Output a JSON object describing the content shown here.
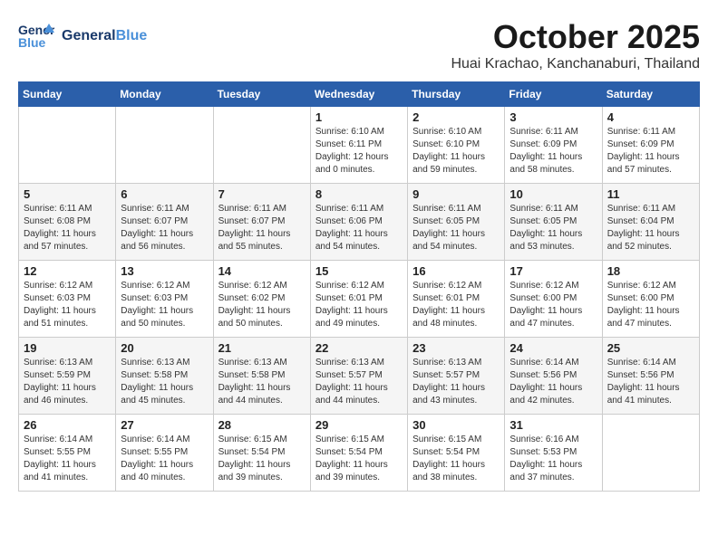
{
  "header": {
    "logo": {
      "line1": "General",
      "line2": "Blue",
      "tagline": ""
    },
    "month": "October 2025",
    "location": "Huai Krachao, Kanchanaburi, Thailand"
  },
  "weekdays": [
    "Sunday",
    "Monday",
    "Tuesday",
    "Wednesday",
    "Thursday",
    "Friday",
    "Saturday"
  ],
  "rows": [
    [
      {
        "day": "",
        "content": ""
      },
      {
        "day": "",
        "content": ""
      },
      {
        "day": "",
        "content": ""
      },
      {
        "day": "1",
        "content": "Sunrise: 6:10 AM\nSunset: 6:11 PM\nDaylight: 12 hours\nand 0 minutes."
      },
      {
        "day": "2",
        "content": "Sunrise: 6:10 AM\nSunset: 6:10 PM\nDaylight: 11 hours\nand 59 minutes."
      },
      {
        "day": "3",
        "content": "Sunrise: 6:11 AM\nSunset: 6:09 PM\nDaylight: 11 hours\nand 58 minutes."
      },
      {
        "day": "4",
        "content": "Sunrise: 6:11 AM\nSunset: 6:09 PM\nDaylight: 11 hours\nand 57 minutes."
      }
    ],
    [
      {
        "day": "5",
        "content": "Sunrise: 6:11 AM\nSunset: 6:08 PM\nDaylight: 11 hours\nand 57 minutes."
      },
      {
        "day": "6",
        "content": "Sunrise: 6:11 AM\nSunset: 6:07 PM\nDaylight: 11 hours\nand 56 minutes."
      },
      {
        "day": "7",
        "content": "Sunrise: 6:11 AM\nSunset: 6:07 PM\nDaylight: 11 hours\nand 55 minutes."
      },
      {
        "day": "8",
        "content": "Sunrise: 6:11 AM\nSunset: 6:06 PM\nDaylight: 11 hours\nand 54 minutes."
      },
      {
        "day": "9",
        "content": "Sunrise: 6:11 AM\nSunset: 6:05 PM\nDaylight: 11 hours\nand 54 minutes."
      },
      {
        "day": "10",
        "content": "Sunrise: 6:11 AM\nSunset: 6:05 PM\nDaylight: 11 hours\nand 53 minutes."
      },
      {
        "day": "11",
        "content": "Sunrise: 6:11 AM\nSunset: 6:04 PM\nDaylight: 11 hours\nand 52 minutes."
      }
    ],
    [
      {
        "day": "12",
        "content": "Sunrise: 6:12 AM\nSunset: 6:03 PM\nDaylight: 11 hours\nand 51 minutes."
      },
      {
        "day": "13",
        "content": "Sunrise: 6:12 AM\nSunset: 6:03 PM\nDaylight: 11 hours\nand 50 minutes."
      },
      {
        "day": "14",
        "content": "Sunrise: 6:12 AM\nSunset: 6:02 PM\nDaylight: 11 hours\nand 50 minutes."
      },
      {
        "day": "15",
        "content": "Sunrise: 6:12 AM\nSunset: 6:01 PM\nDaylight: 11 hours\nand 49 minutes."
      },
      {
        "day": "16",
        "content": "Sunrise: 6:12 AM\nSunset: 6:01 PM\nDaylight: 11 hours\nand 48 minutes."
      },
      {
        "day": "17",
        "content": "Sunrise: 6:12 AM\nSunset: 6:00 PM\nDaylight: 11 hours\nand 47 minutes."
      },
      {
        "day": "18",
        "content": "Sunrise: 6:12 AM\nSunset: 6:00 PM\nDaylight: 11 hours\nand 47 minutes."
      }
    ],
    [
      {
        "day": "19",
        "content": "Sunrise: 6:13 AM\nSunset: 5:59 PM\nDaylight: 11 hours\nand 46 minutes."
      },
      {
        "day": "20",
        "content": "Sunrise: 6:13 AM\nSunset: 5:58 PM\nDaylight: 11 hours\nand 45 minutes."
      },
      {
        "day": "21",
        "content": "Sunrise: 6:13 AM\nSunset: 5:58 PM\nDaylight: 11 hours\nand 44 minutes."
      },
      {
        "day": "22",
        "content": "Sunrise: 6:13 AM\nSunset: 5:57 PM\nDaylight: 11 hours\nand 44 minutes."
      },
      {
        "day": "23",
        "content": "Sunrise: 6:13 AM\nSunset: 5:57 PM\nDaylight: 11 hours\nand 43 minutes."
      },
      {
        "day": "24",
        "content": "Sunrise: 6:14 AM\nSunset: 5:56 PM\nDaylight: 11 hours\nand 42 minutes."
      },
      {
        "day": "25",
        "content": "Sunrise: 6:14 AM\nSunset: 5:56 PM\nDaylight: 11 hours\nand 41 minutes."
      }
    ],
    [
      {
        "day": "26",
        "content": "Sunrise: 6:14 AM\nSunset: 5:55 PM\nDaylight: 11 hours\nand 41 minutes."
      },
      {
        "day": "27",
        "content": "Sunrise: 6:14 AM\nSunset: 5:55 PM\nDaylight: 11 hours\nand 40 minutes."
      },
      {
        "day": "28",
        "content": "Sunrise: 6:15 AM\nSunset: 5:54 PM\nDaylight: 11 hours\nand 39 minutes."
      },
      {
        "day": "29",
        "content": "Sunrise: 6:15 AM\nSunset: 5:54 PM\nDaylight: 11 hours\nand 39 minutes."
      },
      {
        "day": "30",
        "content": "Sunrise: 6:15 AM\nSunset: 5:54 PM\nDaylight: 11 hours\nand 38 minutes."
      },
      {
        "day": "31",
        "content": "Sunrise: 6:16 AM\nSunset: 5:53 PM\nDaylight: 11 hours\nand 37 minutes."
      },
      {
        "day": "",
        "content": ""
      }
    ]
  ]
}
